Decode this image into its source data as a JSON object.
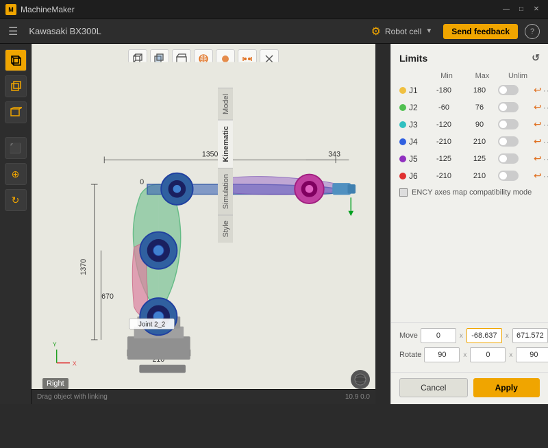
{
  "titlebar": {
    "app_name": "MachineMaker",
    "minimize": "—",
    "maximize": "□",
    "close": "✕"
  },
  "topbar": {
    "title": "Kawasaki BX300L",
    "robot_cell_label": "Robot cell",
    "feedback_label": "Send feedback",
    "help_label": "?"
  },
  "toolbar": {
    "icons": [
      "⬛",
      "⬛",
      "⬛",
      "⬛",
      "⬛",
      "⬛"
    ]
  },
  "viewport": {
    "view_label": "Right",
    "status_text": "Drag object with linking",
    "coords": "10.9 0.0"
  },
  "side_tabs": [
    {
      "label": "Model",
      "active": false
    },
    {
      "label": "Kinematic",
      "active": true
    },
    {
      "label": "Simulation",
      "active": false
    },
    {
      "label": "Style",
      "active": false
    }
  ],
  "limits_panel": {
    "title": "Limits",
    "columns": {
      "min": "Min",
      "max": "Max",
      "unlim": "Unlim"
    },
    "joints": [
      {
        "label": "J1",
        "dot": "yellow",
        "min": "-180",
        "max": "180",
        "toggle": false
      },
      {
        "label": "J2",
        "dot": "green",
        "min": "-60",
        "max": "76",
        "toggle": false
      },
      {
        "label": "J3",
        "dot": "cyan",
        "min": "-120",
        "max": "90",
        "toggle": false
      },
      {
        "label": "J4",
        "dot": "blue",
        "min": "-210",
        "max": "210",
        "toggle": false
      },
      {
        "label": "J5",
        "dot": "purple",
        "min": "-125",
        "max": "125",
        "toggle": false
      },
      {
        "label": "J6",
        "dot": "red",
        "min": "-210",
        "max": "210",
        "toggle": false
      }
    ],
    "ency_label": "ENCY axes map compatibility mode"
  },
  "move_rotate": {
    "move_label": "Move",
    "move_x": "0",
    "move_y": "-68.637",
    "move_z": "671.572",
    "rotate_label": "Rotate",
    "rotate_x": "90",
    "rotate_y": "0",
    "rotate_z": "90"
  },
  "buttons": {
    "cancel": "Cancel",
    "apply": "Apply"
  },
  "dimensions": {
    "d1350": "1350",
    "d343": "343",
    "d1370": "1370",
    "d670": "670",
    "d210": "210",
    "d0": "0",
    "joint_label": "Joint 2_2"
  }
}
